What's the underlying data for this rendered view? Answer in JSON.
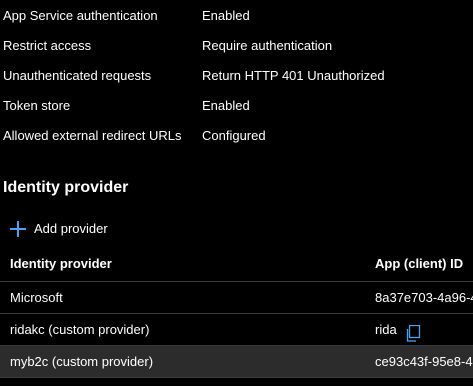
{
  "properties": [
    {
      "label": "App Service authentication",
      "value": "Enabled"
    },
    {
      "label": "Restrict access",
      "value": "Require authentication"
    },
    {
      "label": "Unauthenticated requests",
      "value": "Return HTTP 401 Unauthorized"
    },
    {
      "label": "Token store",
      "value": "Enabled"
    },
    {
      "label": "Allowed external redirect URLs",
      "value": "Configured"
    }
  ],
  "identity_section": {
    "title": "Identity provider",
    "add_label": "Add provider",
    "add_icon": "plus-icon",
    "columns": [
      "Identity provider",
      "App (client) ID"
    ],
    "rows": [
      {
        "provider": "Microsoft",
        "client_id": "8a37e703-4a96-4"
      },
      {
        "provider": "ridakc (custom provider)",
        "client_id": "rida",
        "icon": "copy-icon"
      },
      {
        "provider": "myb2c (custom provider)",
        "client_id": "ce93c43f-95e8-4"
      }
    ]
  },
  "colors": {
    "background": "#000000",
    "text": "#ffffff",
    "accent": "#4aa3f0",
    "selected_row": "#2c2c2c",
    "divider": "#3b3b3b"
  }
}
